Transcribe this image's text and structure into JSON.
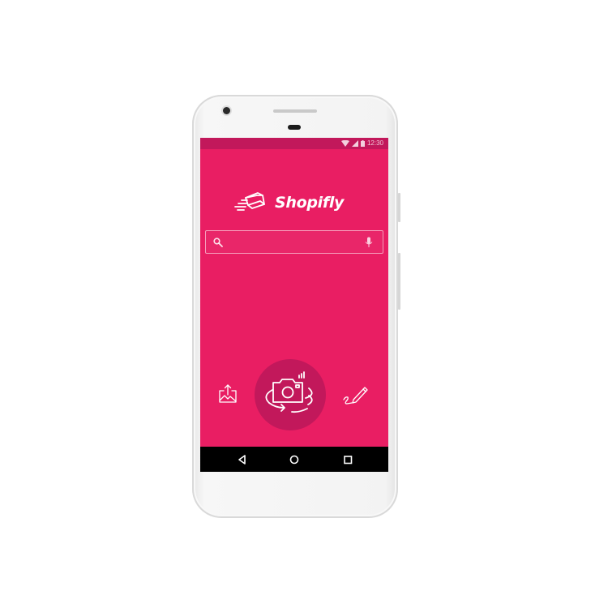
{
  "status_bar": {
    "time": "12:30",
    "icons": [
      "wifi-icon",
      "signal-icon",
      "battery-icon"
    ]
  },
  "app": {
    "name": "Shopifly",
    "logo_icon": "flying-wallet-icon"
  },
  "search": {
    "placeholder": "",
    "value": "",
    "leading_icon": "search-icon",
    "trailing_icon": "microphone-icon"
  },
  "actions": [
    {
      "id": "gallery",
      "icon": "image-upload-icon"
    },
    {
      "id": "camera",
      "icon": "camera-rotate-icon"
    },
    {
      "id": "draw",
      "icon": "pencil-draw-icon"
    }
  ],
  "navigation": [
    {
      "id": "back",
      "icon": "back-triangle-icon"
    },
    {
      "id": "home",
      "icon": "home-circle-icon"
    },
    {
      "id": "recents",
      "icon": "recents-square-icon"
    }
  ],
  "colors": {
    "primary": "#e91e63",
    "primary_dark": "#c2185b",
    "nav_bar": "#000000",
    "device_body": "#f3f3f3",
    "foreground": "#ffffff"
  }
}
